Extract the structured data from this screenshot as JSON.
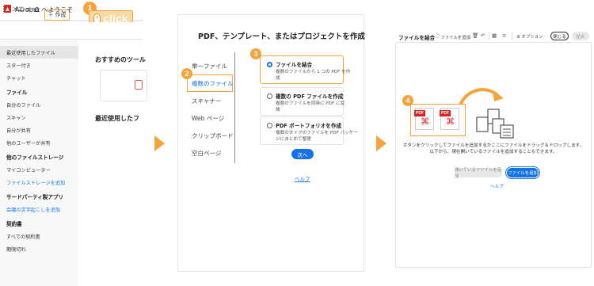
{
  "colors": {
    "callout": "#f6a33a",
    "click_fill": "#f9d9a5",
    "accent_blue": "#1473e6",
    "acrobat_red": "#d7261f",
    "sidebar_bg": "#f8f8f8"
  },
  "callouts": [
    "1",
    "2",
    "3",
    "4"
  ],
  "panel1": {
    "menu_label": "メニュー",
    "menu_icon": "hamburger-icon",
    "home_icon": "home-icon",
    "create_label": "作成",
    "click_label": "click",
    "app_title": "Acrobat へようこそ",
    "sidebar": [
      {
        "type": "item",
        "label": "最近使用したファイル",
        "active": true
      },
      {
        "type": "item",
        "label": "スター付き"
      },
      {
        "type": "item",
        "label": "チャット"
      },
      {
        "type": "head",
        "label": "ファイル"
      },
      {
        "type": "item",
        "label": "自分のファイル"
      },
      {
        "type": "item",
        "label": "スキャン"
      },
      {
        "type": "item",
        "label": "自分が共有"
      },
      {
        "type": "item",
        "label": "他のユーザーが共有"
      },
      {
        "type": "head",
        "label": "他のファイルストレージ"
      },
      {
        "type": "item",
        "label": "マイコンピューター"
      },
      {
        "type": "link",
        "label": "ファイルストレージを追加"
      },
      {
        "type": "head",
        "label": "サードパーティ製アプリ"
      },
      {
        "type": "link",
        "label": "会議の文字起こしを追加"
      },
      {
        "type": "head",
        "label": "契約書"
      },
      {
        "type": "item",
        "label": "すべての契約書"
      },
      {
        "type": "item",
        "label": "期限切れ"
      }
    ],
    "recommended_tools": "おすすめのツール",
    "recently_used": "最近使用したフ"
  },
  "panel2": {
    "title": "PDF、テンプレート、またはプロジェクトを作成",
    "nav": [
      {
        "label": "単一ファイル",
        "selected": false
      },
      {
        "label": "複数のファイル",
        "selected": true
      },
      {
        "label": "スキャナー",
        "selected": false
      },
      {
        "label": "Web ページ",
        "selected": false
      },
      {
        "label": "クリップボード",
        "selected": false
      },
      {
        "label": "空白ページ",
        "selected": false
      }
    ],
    "options": [
      {
        "title": "ファイルを結合",
        "desc1": "複数のファイルから 1 つの PDF を作",
        "desc2": "成",
        "selected": true
      },
      {
        "title": "複数の PDF ファイルを作成",
        "desc1": "複数のファイルを同時に PDF に変",
        "desc2": "換",
        "selected": false
      },
      {
        "title": "PDF ポートフォリオを作成",
        "desc1": "複数のタイプのファイルを PDF パッケー",
        "desc2": "ジにまとめて整理",
        "selected": false
      }
    ],
    "next_label": "次へ",
    "help_label": "ヘルプ"
  },
  "panel3": {
    "title": "ファイルを結合",
    "add_files_label": "ファイルを追加",
    "options_label": "オプション",
    "close_label": "閉じる",
    "combine_label": "結合",
    "pdf_tag": "PDF",
    "instruction_line1": "ボタンをクリックしてファイルを追加するかここにファイルをドラッグ＆ドロップします。",
    "instruction_line2": "以下から、現在開いているファイルを追加することもできます。",
    "open_files_label": "開いているファイルを追加",
    "add_files_button": "ファイルを追加",
    "help_label": "ヘルプ"
  }
}
